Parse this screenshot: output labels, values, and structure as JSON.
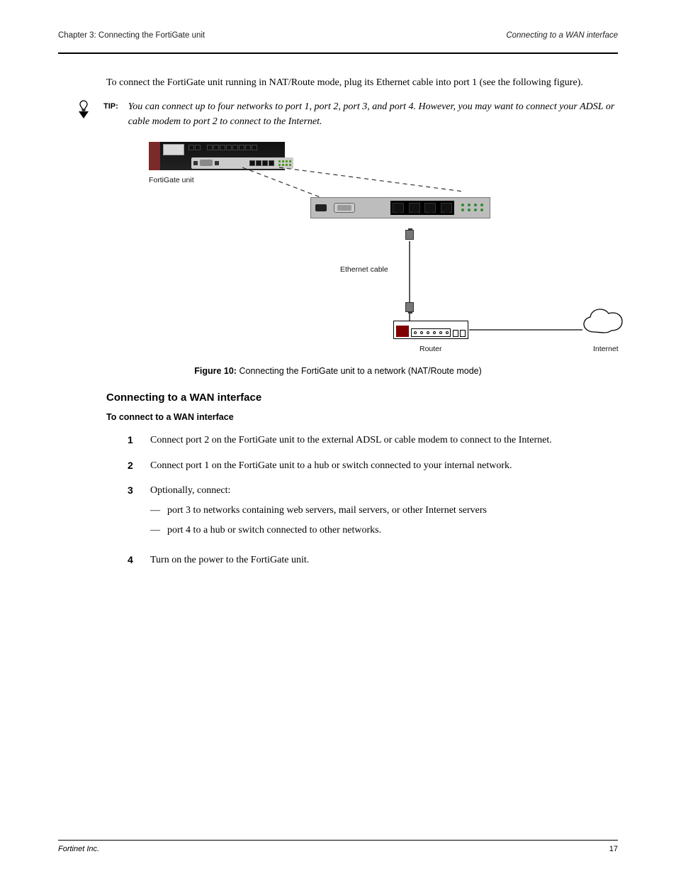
{
  "header": {
    "left": "Chapter 3: Connecting the FortiGate unit",
    "right": "Connecting to a WAN interface"
  },
  "intro_para": "To connect the FortiGate unit running in NAT/Route mode, plug its Ethernet cable into port 1 (see the following figure).",
  "tip": {
    "label": "TIP:",
    "text": "You can connect up to four networks to port 1, port 2, port 3, and port 4. However, you may want to connect your ADSL or cable modem to port 2 to connect to the Internet."
  },
  "diagram": {
    "device_label": "FortiGate unit",
    "cable_label": "Ethernet cable",
    "router_label": "Router",
    "cloud_label": "Internet"
  },
  "figure": {
    "num": "Figure 10:",
    "caption": "Connecting the FortiGate unit to a network (NAT/Route mode)"
  },
  "section_title": "Connecting to a WAN interface",
  "para_after_h3": "To connect to a WAN interface",
  "steps": {
    "s1": "Connect port 2 on the FortiGate unit to the external ADSL or cable modem to connect to the Internet.",
    "s2": "Connect port 1 on the FortiGate unit to a hub or switch connected to your internal network.",
    "s3_lead": "Optionally, connect:",
    "s3_a": "port 3 to networks containing web servers, mail servers, or other Internet servers",
    "s3_b": "port 4 to a hub or switch connected to other networks.",
    "s4": "Turn on the power to the FortiGate unit."
  },
  "footer": {
    "left": "Fortinet Inc.",
    "right": "17"
  }
}
